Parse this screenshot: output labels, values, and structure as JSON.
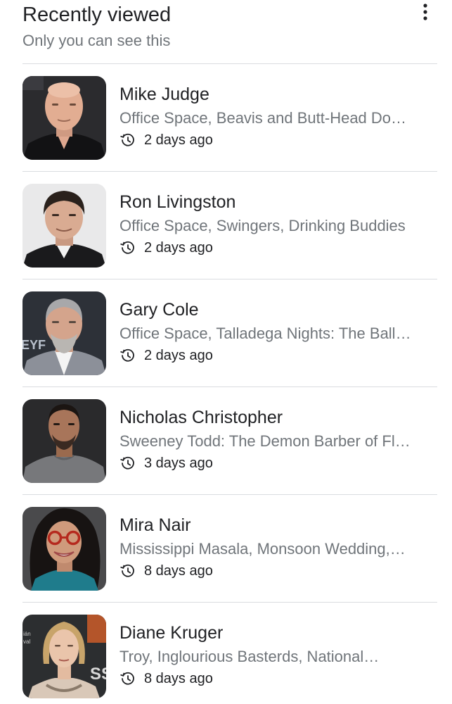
{
  "header": {
    "title": "Recently viewed",
    "subtitle": "Only you can see this",
    "menu_icon": "more-vert-icon"
  },
  "items": [
    {
      "name": "Mike Judge",
      "description": "Office Space, Beavis and Butt-Head Do…",
      "time": "2 days ago",
      "icon": "history-icon"
    },
    {
      "name": "Ron Livingston",
      "description": "Office Space, Swingers, Drinking Buddies",
      "time": "2 days ago",
      "icon": "history-icon"
    },
    {
      "name": "Gary Cole",
      "description": "Office Space, Talladega Nights: The Ball…",
      "time": "2 days ago",
      "icon": "history-icon"
    },
    {
      "name": "Nicholas Christopher",
      "description": "Sweeney Todd: The Demon Barber of Fl…",
      "time": "3 days ago",
      "icon": "history-icon"
    },
    {
      "name": "Mira Nair",
      "description": "Mississippi Masala, Monsoon Wedding,…",
      "time": "8 days ago",
      "icon": "history-icon"
    },
    {
      "name": "Diane Kruger",
      "description": "Troy, Inglourious Basterds, National…",
      "time": "8 days ago",
      "icon": "history-icon"
    }
  ],
  "colors": {
    "text_primary": "#202124",
    "text_secondary": "#70757a",
    "divider": "#dadce0"
  }
}
